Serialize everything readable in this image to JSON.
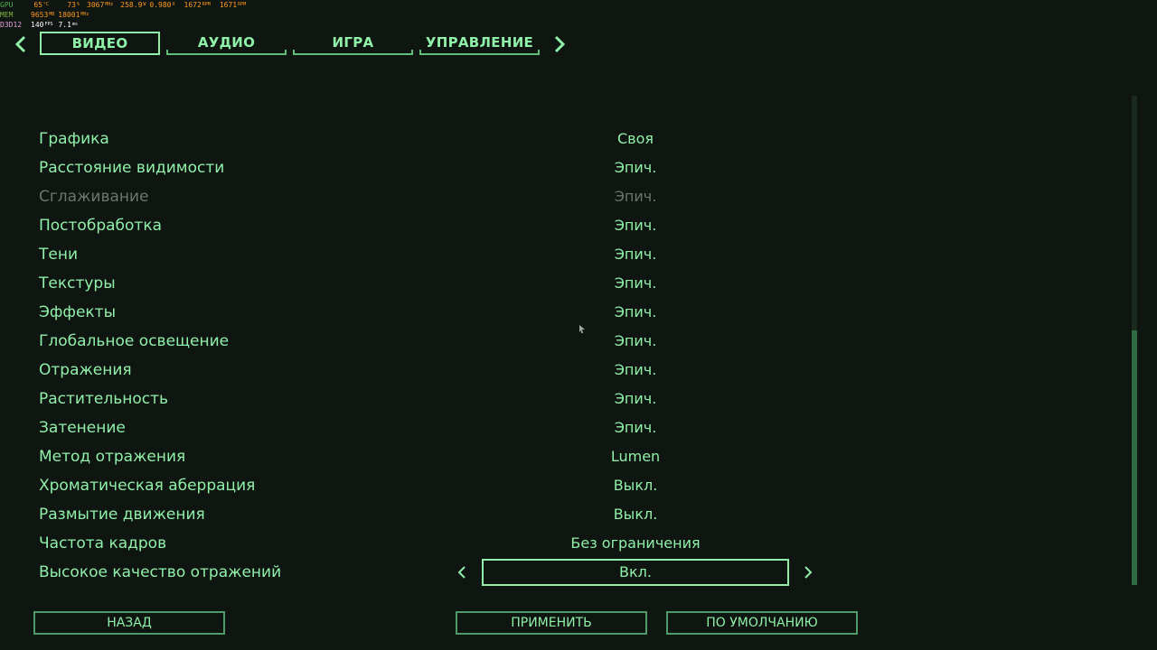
{
  "overlay": {
    "gpu": {
      "label": "GPU",
      "temp": "65",
      "temp_unit": "°C",
      "load": "73",
      "load_unit": "%",
      "clock": "3067",
      "clock_unit": "MHz",
      "power": "258.9",
      "power_unit": "W",
      "volt": "0.980",
      "volt_unit": "V",
      "fan1": "1672",
      "fan1_unit": "RPM",
      "fan2": "1671",
      "fan2_unit": "RPM"
    },
    "mem": {
      "label": "MEM",
      "used": "9653",
      "used_unit": "MB",
      "clock": "18001",
      "clock_unit": "MHz"
    },
    "d3d": {
      "label": "D3D12",
      "fps": "140",
      "fps_unit": "FPS",
      "frametime": "7.1",
      "frametime_unit": "ms"
    }
  },
  "tabs": [
    "ВИДЕО",
    "АУДИО",
    "ИГРА",
    "УПРАВЛЕНИЕ"
  ],
  "active_tab": "ВИДЕО",
  "settings": [
    {
      "label": "Графика",
      "value": "Своя"
    },
    {
      "label": "Расстояние видимости",
      "value": "Эпич."
    },
    {
      "label": "Сглаживание",
      "value": "Эпич.",
      "disabled": true
    },
    {
      "label": "Постобработка",
      "value": "Эпич."
    },
    {
      "label": "Тени",
      "value": "Эпич."
    },
    {
      "label": "Текстуры",
      "value": "Эпич."
    },
    {
      "label": "Эффекты",
      "value": "Эпич."
    },
    {
      "label": "Глобальное освещение",
      "value": "Эпич."
    },
    {
      "label": "Отражения",
      "value": "Эпич."
    },
    {
      "label": "Растительность",
      "value": "Эпич."
    },
    {
      "label": "Затенение",
      "value": "Эпич."
    },
    {
      "label": "Метод отражения",
      "value": "Lumen"
    },
    {
      "label": "Хроматическая аберрация",
      "value": "Выкл."
    },
    {
      "label": "Размытие движения",
      "value": "Выкл."
    },
    {
      "label": "Частота кадров",
      "value": "Без ограничения"
    },
    {
      "label": "Высокое качество отражений",
      "value": "Вкл.",
      "selected": true
    }
  ],
  "scroll": {
    "position_fraction": 0.48,
    "visible_fraction": 0.52
  },
  "buttons": {
    "back": "НАЗАД",
    "apply": "ПРИМЕНИТЬ",
    "default": "ПО УМОЛЧАНИЮ"
  },
  "colors": {
    "accent": "#8ff0a8",
    "background": "#0f1511",
    "disabled": "#6d7570",
    "overlay_values": "#ff9a1e"
  }
}
